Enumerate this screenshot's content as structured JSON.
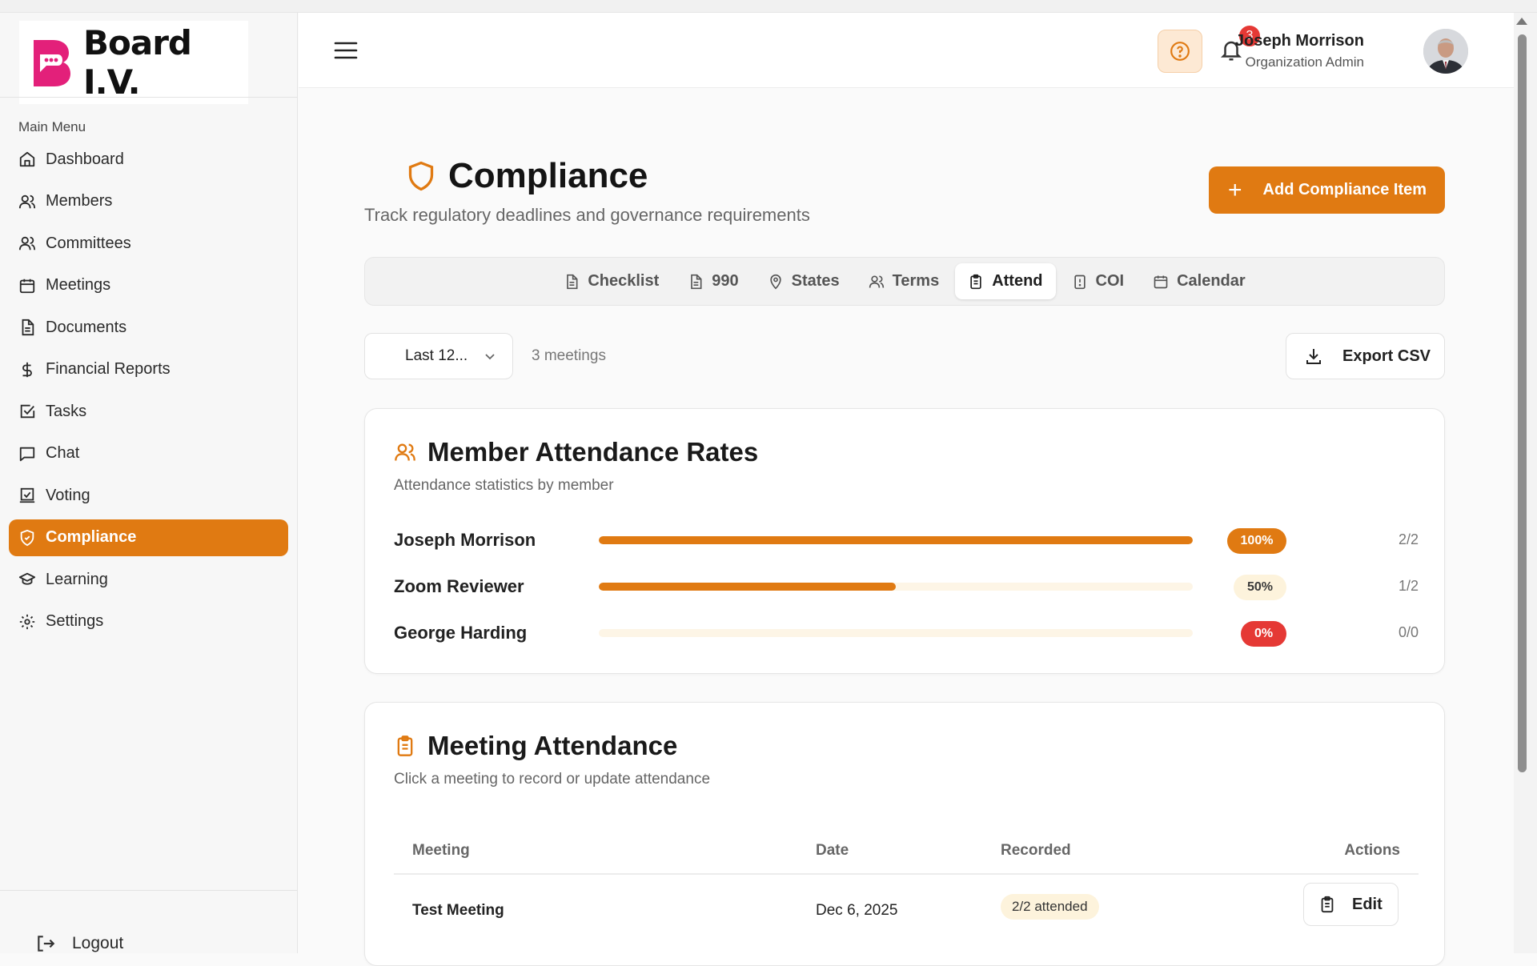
{
  "brand": {
    "name": "Board I.V."
  },
  "sidebar": {
    "menu_title": "Main Menu",
    "items": [
      {
        "label": "Dashboard",
        "icon": "home-icon"
      },
      {
        "label": "Members",
        "icon": "users-icon"
      },
      {
        "label": "Committees",
        "icon": "users-icon"
      },
      {
        "label": "Meetings",
        "icon": "calendar-icon"
      },
      {
        "label": "Documents",
        "icon": "document-icon"
      },
      {
        "label": "Financial Reports",
        "icon": "dollar-icon"
      },
      {
        "label": "Tasks",
        "icon": "checkbox-icon"
      },
      {
        "label": "Chat",
        "icon": "chat-icon"
      },
      {
        "label": "Voting",
        "icon": "vote-icon"
      },
      {
        "label": "Compliance",
        "icon": "shield-icon",
        "active": true
      },
      {
        "label": "Learning",
        "icon": "graduation-cap-icon"
      },
      {
        "label": "Settings",
        "icon": "gear-icon"
      }
    ],
    "logout_label": "Logout"
  },
  "header": {
    "notification_count": "3",
    "user_name": "Joseph Morrison",
    "user_role": "Organization Admin"
  },
  "page": {
    "title": "Compliance",
    "subtitle": "Track regulatory deadlines and governance requirements",
    "add_button": "Add Compliance Item",
    "add_button_icon": "+"
  },
  "tabs": [
    {
      "label": "Checklist",
      "icon": "document-icon"
    },
    {
      "label": "990",
      "icon": "document-icon"
    },
    {
      "label": "States",
      "icon": "map-pin-icon"
    },
    {
      "label": "Terms",
      "icon": "users-icon"
    },
    {
      "label": "Attend",
      "icon": "clipboard-icon",
      "active": true
    },
    {
      "label": "COI",
      "icon": "alert-file-icon"
    },
    {
      "label": "Calendar",
      "icon": "calendar-icon"
    }
  ],
  "filters": {
    "period_value": "Last 12...",
    "meeting_count": "3 meetings",
    "export_label": "Export CSV"
  },
  "attendance_rates": {
    "title": "Member Attendance Rates",
    "subtitle": "Attendance statistics by member",
    "rows": [
      {
        "name": "Joseph Morrison",
        "rate": 100,
        "rate_label": "100%",
        "ratio": "2/2",
        "level": "hi"
      },
      {
        "name": "Zoom Reviewer",
        "rate": 50,
        "rate_label": "50%",
        "ratio": "1/2",
        "level": "mid"
      },
      {
        "name": "George Harding",
        "rate": 0,
        "rate_label": "0%",
        "ratio": "0/0",
        "level": "lo"
      }
    ]
  },
  "meeting_attendance": {
    "title": "Meeting Attendance",
    "subtitle": "Click a meeting to record or update attendance",
    "columns": {
      "meeting": "Meeting",
      "date": "Date",
      "recorded": "Recorded",
      "actions": "Actions"
    },
    "rows": [
      {
        "meeting": "Test Meeting",
        "date": "Dec 6, 2025",
        "recorded": "2/2 attended",
        "action": "Edit"
      }
    ]
  },
  "colors": {
    "accent": "#e07a12",
    "danger": "#e53935",
    "pill_light": "#fdf3dc"
  }
}
